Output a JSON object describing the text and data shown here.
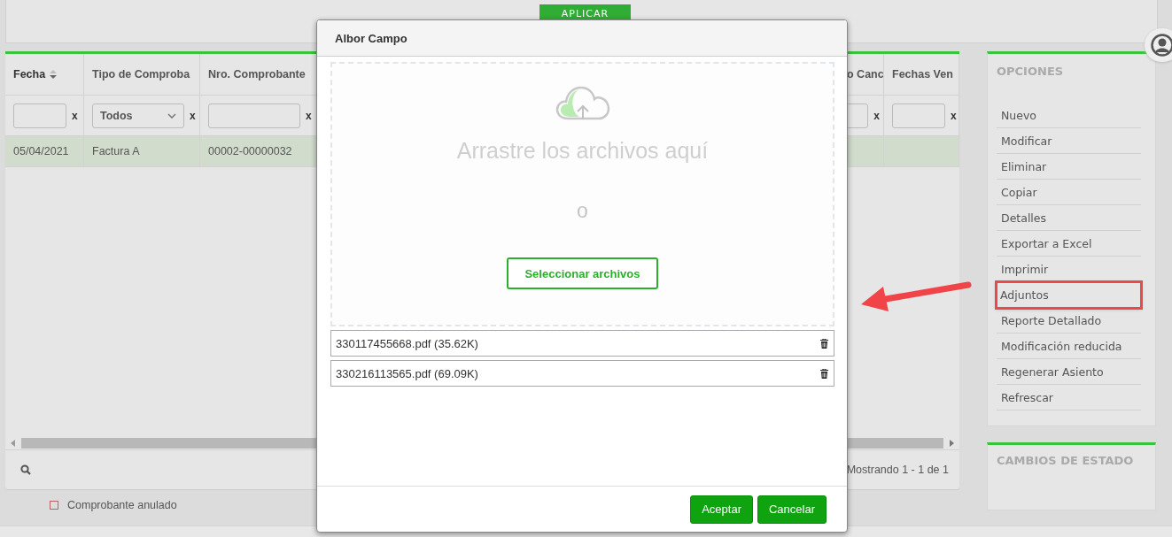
{
  "top_bar": {
    "apply_button": "APLICAR"
  },
  "table": {
    "columns": [
      {
        "label": "Fecha",
        "sorted": true
      },
      {
        "label": "Tipo de Comproba",
        "sorted": false
      },
      {
        "label": "Nro. Comprobante",
        "sorted": false
      },
      {
        "label": "o Canc",
        "sorted": false
      },
      {
        "label": "Fechas Ven",
        "sorted": false
      }
    ],
    "filters": [
      {
        "kind": "text",
        "clear": "x"
      },
      {
        "kind": "select",
        "value": "Todos",
        "clear": "x"
      },
      {
        "kind": "text",
        "clear": "x"
      },
      {
        "kind": "text",
        "clear": "x"
      },
      {
        "kind": "text",
        "clear": "x"
      }
    ],
    "rows": [
      {
        "cells": [
          "05/04/2021",
          "Factura A",
          "00002-00000032"
        ],
        "selected": true
      }
    ],
    "status": "Mostrando 1 - 1 de 1"
  },
  "legend": {
    "label": "Comprobante anulado"
  },
  "options": {
    "title": "OPCIONES",
    "items": [
      {
        "label": "Nuevo",
        "highlighted": false
      },
      {
        "label": "Modificar",
        "highlighted": false
      },
      {
        "label": "Eliminar",
        "highlighted": false
      },
      {
        "label": "Copiar",
        "highlighted": false
      },
      {
        "label": "Detalles",
        "highlighted": false
      },
      {
        "label": "Exportar a Excel",
        "highlighted": false
      },
      {
        "label": "Imprimir",
        "highlighted": false
      },
      {
        "label": "Adjuntos",
        "highlighted": true
      },
      {
        "label": "Reporte Detallado",
        "highlighted": false
      },
      {
        "label": "Modificación reducida",
        "highlighted": false
      },
      {
        "label": "Regenerar Asiento",
        "highlighted": false
      },
      {
        "label": "Refrescar",
        "highlighted": false
      }
    ]
  },
  "state_changes": {
    "title": "CAMBIOS DE ESTADO"
  },
  "modal": {
    "title": "Albor Campo",
    "dropzone": {
      "message": "Arrastre los archivos aquí",
      "separator": "o",
      "button": "Seleccionar archivos"
    },
    "files": [
      {
        "name": "330117455668.pdf (35.62K)"
      },
      {
        "name": "330216113565.pdf (69.09K)"
      }
    ],
    "buttons": [
      {
        "label": "Aceptar"
      },
      {
        "label": "Cancelar"
      }
    ]
  }
}
